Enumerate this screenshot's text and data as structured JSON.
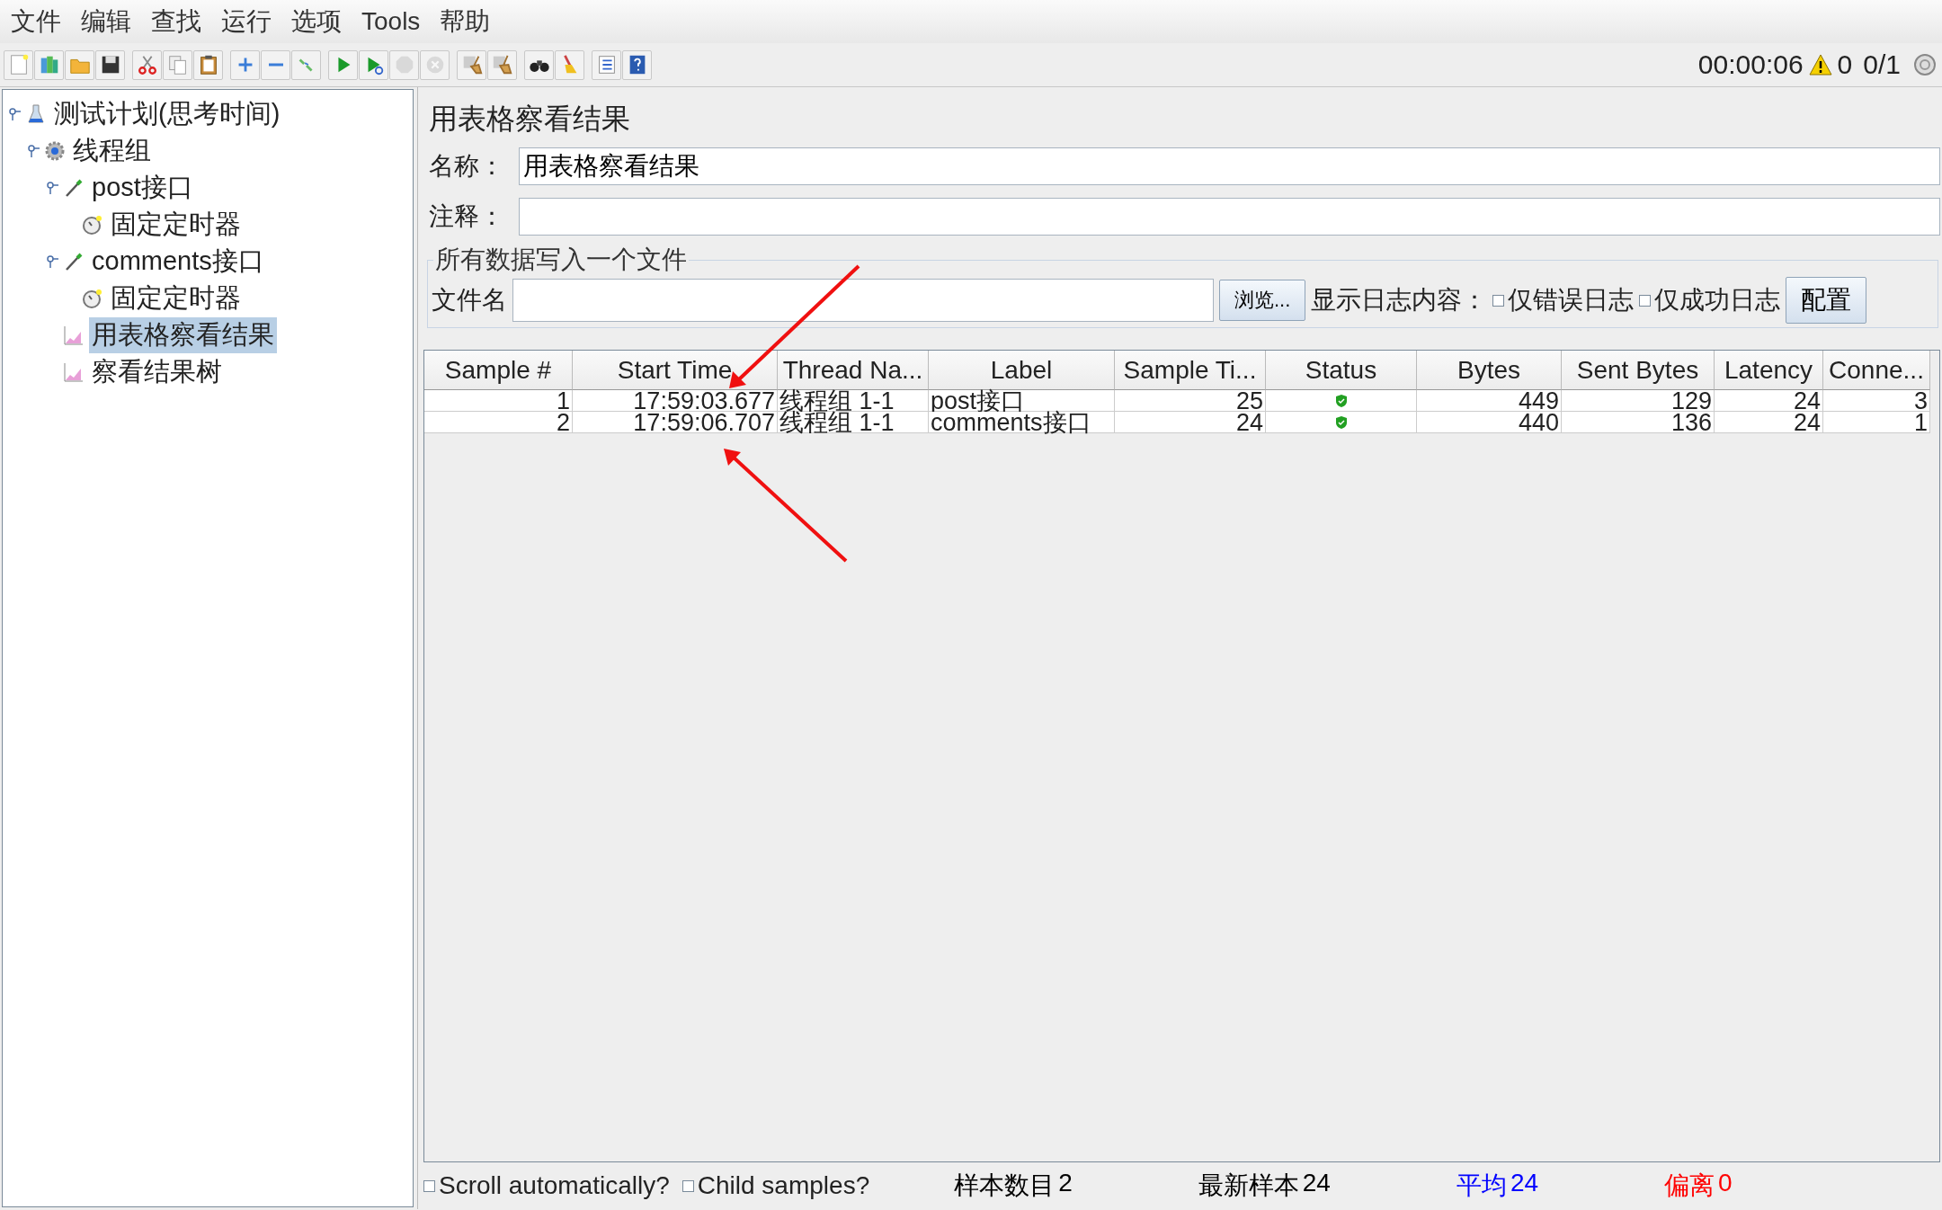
{
  "menu": [
    {
      "label": "文件"
    },
    {
      "label": "编辑"
    },
    {
      "label": "查找"
    },
    {
      "label": "运行"
    },
    {
      "label": "选项"
    },
    {
      "label": "Tools"
    },
    {
      "label": "帮助"
    }
  ],
  "toolbar": [
    [
      {
        "kind": "new",
        "disabled": false
      },
      {
        "kind": "templates",
        "disabled": false
      },
      {
        "kind": "open",
        "disabled": false
      },
      {
        "kind": "save",
        "disabled": false
      }
    ],
    [
      {
        "kind": "cut",
        "disabled": false
      },
      {
        "kind": "copy",
        "disabled": false
      },
      {
        "kind": "paste",
        "disabled": false
      }
    ],
    [
      {
        "kind": "expand",
        "disabled": false
      },
      {
        "kind": "collapse",
        "disabled": false
      },
      {
        "kind": "toggle",
        "disabled": false
      }
    ],
    [
      {
        "kind": "start",
        "disabled": false
      },
      {
        "kind": "start_no_pause",
        "disabled": false
      },
      {
        "kind": "stop",
        "disabled": true
      },
      {
        "kind": "shutdown",
        "disabled": true
      }
    ],
    [
      {
        "kind": "clear",
        "disabled": false
      },
      {
        "kind": "clear_all",
        "disabled": false
      }
    ],
    [
      {
        "kind": "search",
        "disabled": false
      },
      {
        "kind": "reset_search",
        "disabled": false
      }
    ],
    [
      {
        "kind": "functions",
        "disabled": false
      },
      {
        "kind": "help",
        "disabled": false
      }
    ]
  ],
  "run_status": {
    "elapsed": "00:00:06",
    "warnings": "0",
    "threads": "0/1"
  },
  "tree": [
    {
      "label": "测试计划(思考时间)",
      "kind": "plan",
      "selected": false,
      "children": [
        {
          "label": "线程组",
          "kind": "thread_group",
          "selected": false,
          "children": [
            {
              "label": "post接口",
              "kind": "sampler",
              "selected": false,
              "children": [
                {
                  "label": "固定定时器",
                  "kind": "timer",
                  "selected": false
                }
              ]
            },
            {
              "label": "comments接口",
              "kind": "sampler",
              "selected": false,
              "children": [
                {
                  "label": "固定定时器",
                  "kind": "timer",
                  "selected": false
                }
              ]
            },
            {
              "label": "用表格察看结果",
              "kind": "listener",
              "selected": true
            },
            {
              "label": "察看结果树",
              "kind": "listener",
              "selected": false
            }
          ]
        }
      ]
    }
  ],
  "panel": {
    "title": "用表格察看结果",
    "name_label": "名称：",
    "name_value": "用表格察看结果",
    "comment_label": "注释：",
    "file_group": {
      "legend": "所有数据写入一个文件",
      "filename_label": "文件名",
      "browse_button": "浏览...",
      "log_label": "显示日志内容：",
      "options": [
        {
          "label": "仅错误日志",
          "checked": false
        },
        {
          "label": "仅成功日志",
          "checked": false
        }
      ],
      "configure_button": "配置"
    }
  },
  "table": {
    "columns": [
      {
        "label": "Sample #"
      },
      {
        "label": "Start Time"
      },
      {
        "label": "Thread Na..."
      },
      {
        "label": "Label"
      },
      {
        "label": "Sample Ti..."
      },
      {
        "label": "Status"
      },
      {
        "label": "Bytes"
      },
      {
        "label": "Sent Bytes"
      },
      {
        "label": "Latency"
      },
      {
        "label": "Conne..."
      }
    ],
    "rows": [
      {
        "sample": "1",
        "start_time": "17:59:03.677",
        "thread_name": "线程组 1-1",
        "label": "post接口",
        "sample_time": "25",
        "success": true,
        "bytes": "449",
        "sent_bytes": "129",
        "latency": "24",
        "connect": "3"
      },
      {
        "sample": "2",
        "start_time": "17:59:06.707",
        "thread_name": "线程组 1-1",
        "label": "comments接口",
        "sample_time": "24",
        "success": true,
        "bytes": "440",
        "sent_bytes": "136",
        "latency": "24",
        "connect": "1"
      }
    ]
  },
  "footer": {
    "options": [
      {
        "label": "Scroll automatically?",
        "checked": false
      },
      {
        "label": "Child samples?",
        "checked": false
      }
    ],
    "stats": [
      {
        "label": "样本数目",
        "value": "2",
        "color": "#000000"
      },
      {
        "label": "最新样本",
        "value": "24",
        "color": "#000000"
      },
      {
        "label": "平均",
        "value": "24",
        "color": "#0000ff"
      },
      {
        "label": "偏离",
        "value": "0",
        "color": "#ff0000"
      }
    ]
  }
}
